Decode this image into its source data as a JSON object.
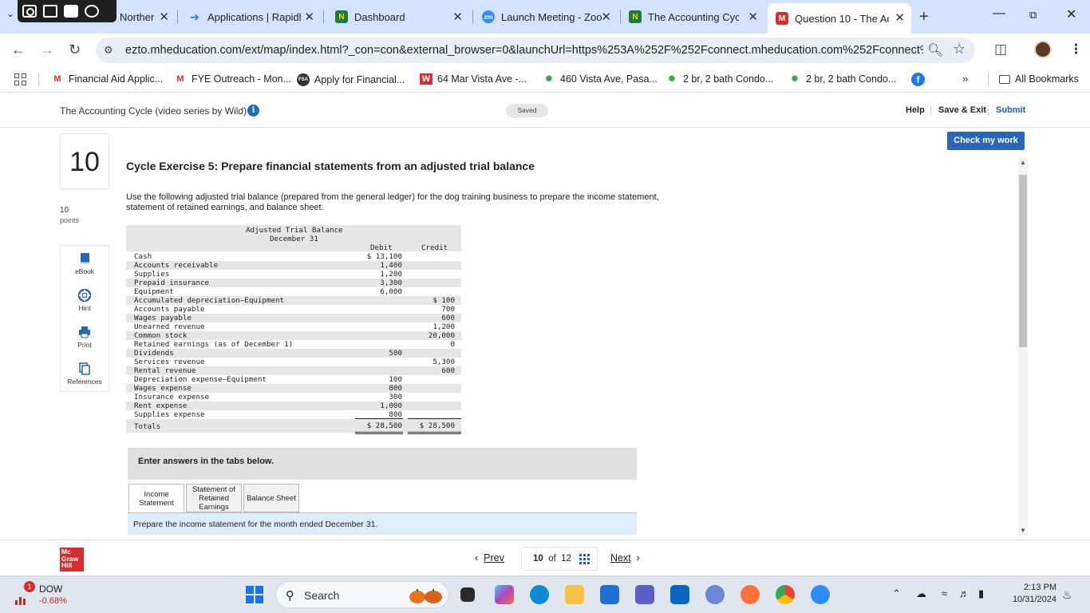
{
  "browser": {
    "tabs": [
      {
        "title": "Norther",
        "icon": "generic-icon",
        "active": false
      },
      {
        "title": "Applications | Rapidl",
        "icon": "rapid-icon",
        "active": false
      },
      {
        "title": "Dashboard",
        "icon": "n-icon",
        "active": false
      },
      {
        "title": "Launch Meeting - Zoo",
        "icon": "zoom-icon",
        "active": false
      },
      {
        "title": "The Accounting Cycle",
        "icon": "n-icon",
        "active": false
      },
      {
        "title": "Question 10 - The Ac",
        "icon": "mheducation-icon",
        "active": true
      }
    ],
    "url": "ezto.mheducation.com/ext/map/index.html?_con=con&external_browser=0&launchUrl=https%253A%252F%252Fconnect.mheducation.com%252Fconnect%25...",
    "bookmarks": [
      {
        "label": "Financial Aid Applic...",
        "icon": "gmail-icon"
      },
      {
        "label": "FYE Outreach - Mon...",
        "icon": "gmail-icon"
      },
      {
        "label": "Apply for Financial...",
        "icon": "fsa-icon"
      },
      {
        "label": "64 Mar Vista Ave -...",
        "icon": "w-icon"
      },
      {
        "label": "460 Vista Ave, Pasa...",
        "icon": "leaf-icon"
      },
      {
        "label": "2 br, 2 bath Condo...",
        "icon": "leaf-icon"
      },
      {
        "label": "2 br, 2 bath Condo...",
        "icon": "leaf-icon"
      }
    ],
    "all_bookmarks": "All Bookmarks"
  },
  "header": {
    "assignment_title": "The Accounting Cycle (video series by Wild)",
    "saved": "Saved",
    "help": "Help",
    "save_exit": "Save & Exit",
    "submit": "Submit"
  },
  "question": {
    "number": "10",
    "points": "10",
    "points_label": "points",
    "check_my_work": "Check my work",
    "heading": "Cycle Exercise 5: Prepare financial statements from an adjusted trial balance",
    "body": "Use the following adjusted trial balance (prepared from the general ledger) for the dog training business to prepare the income statement, statement of retained earnings, and balance sheet.",
    "tools": [
      {
        "label": "eBook",
        "icon": "book-icon"
      },
      {
        "label": "Hint",
        "icon": "lifebuoy-icon"
      },
      {
        "label": "Print",
        "icon": "printer-icon"
      },
      {
        "label": "References",
        "icon": "copy-icon"
      }
    ]
  },
  "trial_balance": {
    "title": "Adjusted Trial Balance",
    "date": "December 31",
    "debit_header": "Debit",
    "credit_header": "Credit",
    "rows": [
      {
        "account": "Cash",
        "debit": "$ 13,100",
        "credit": ""
      },
      {
        "account": "Accounts receivable",
        "debit": "1,400",
        "credit": ""
      },
      {
        "account": "Supplies",
        "debit": "1,200",
        "credit": ""
      },
      {
        "account": "Prepaid insurance",
        "debit": "3,300",
        "credit": ""
      },
      {
        "account": "Equipment",
        "debit": "6,000",
        "credit": ""
      },
      {
        "account": "Accumulated depreciation–Equipment",
        "debit": "",
        "credit": "$ 100"
      },
      {
        "account": "Accounts payable",
        "debit": "",
        "credit": "700"
      },
      {
        "account": "Wages payable",
        "debit": "",
        "credit": "600"
      },
      {
        "account": "Unearned revenue",
        "debit": "",
        "credit": "1,200"
      },
      {
        "account": "Common stock",
        "debit": "",
        "credit": "20,000"
      },
      {
        "account": "Retained earnings (as of December 1)",
        "debit": "",
        "credit": "0"
      },
      {
        "account": "Dividends",
        "debit": "500",
        "credit": ""
      },
      {
        "account": "Services revenue",
        "debit": "",
        "credit": "5,300"
      },
      {
        "account": "Rental revenue",
        "debit": "",
        "credit": "600"
      },
      {
        "account": "Depreciation expense–Equipment",
        "debit": "100",
        "credit": ""
      },
      {
        "account": "Wages expense",
        "debit": "800",
        "credit": ""
      },
      {
        "account": "Insurance expense",
        "debit": "300",
        "credit": ""
      },
      {
        "account": "Rent expense",
        "debit": "1,000",
        "credit": ""
      },
      {
        "account": "Supplies expense",
        "debit": "800",
        "credit": ""
      }
    ],
    "totals_label": "Totals",
    "total_debit": "$ 28,500",
    "total_credit": "$ 28,500"
  },
  "answers": {
    "prompt": "Enter answers in the tabs below.",
    "tabs": [
      "Income Statement",
      "Statement of Retained Earnings",
      "Balance Sheet"
    ],
    "active_tab": 0,
    "instruction": "Prepare the income statement for the month ended December 31."
  },
  "footer": {
    "prev": "Prev",
    "current": "10",
    "of": "of",
    "total": "12",
    "next": "Next",
    "logo_text": "Mc Graw Hill"
  },
  "taskbar": {
    "ticker_name": "DOW",
    "ticker_change": "-0.68%",
    "ticker_badge": "1",
    "search_placeholder": "Search",
    "time": "2:13 PM",
    "date": "10/31/2024"
  },
  "colors": {
    "tab_strip": "#d3e3fd",
    "link_blue": "#1a5eb5",
    "check_button": "#2a66b8",
    "table_shade": "#e6e6e6",
    "instruction_bg": "#dceefb",
    "mh_red": "#d32f2f"
  }
}
